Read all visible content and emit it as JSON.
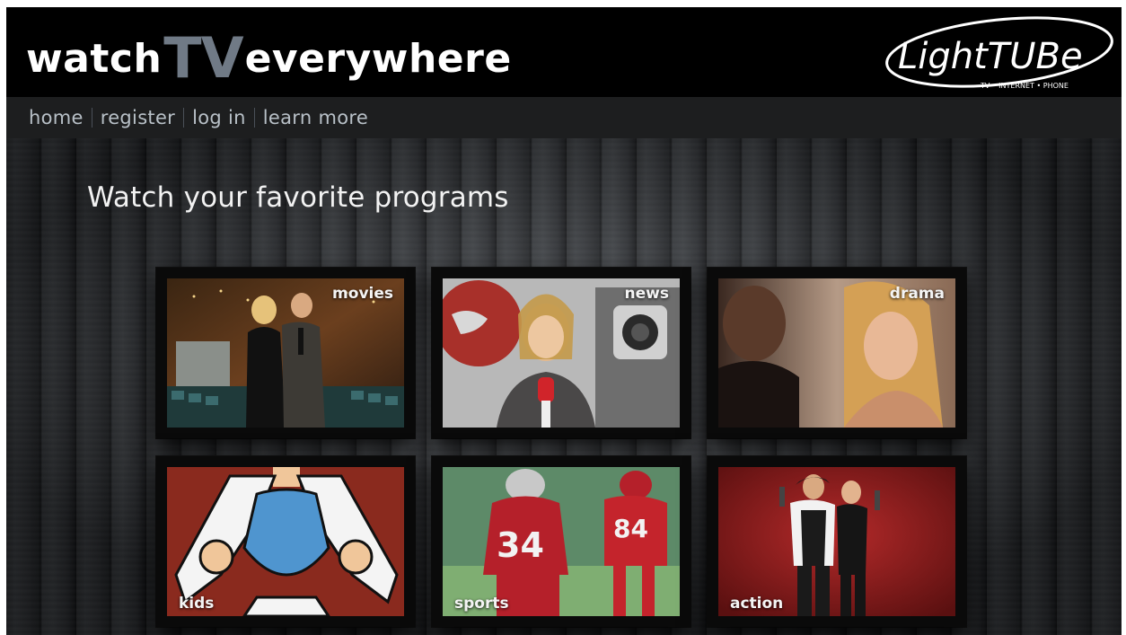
{
  "header": {
    "title_part1": "watch",
    "title_part2": "TV",
    "title_part3": "everywhere",
    "logo_text": "LightTUBe",
    "logo_tagline": "TV • INTERNET • PHONE"
  },
  "nav": {
    "items": [
      {
        "label": "home"
      },
      {
        "label": "register"
      },
      {
        "label": "log in"
      },
      {
        "label": "learn more"
      }
    ]
  },
  "main": {
    "headline": "Watch your favorite programs",
    "categories": [
      {
        "label": "movies"
      },
      {
        "label": "news"
      },
      {
        "label": "drama"
      },
      {
        "label": "kids"
      },
      {
        "label": "sports"
      },
      {
        "label": "action"
      }
    ]
  },
  "colors": {
    "tv_accent": "#707a86",
    "nav_text": "#b8c0c7",
    "nav_bar": "#1d1e1f",
    "header_bg": "#000000"
  }
}
